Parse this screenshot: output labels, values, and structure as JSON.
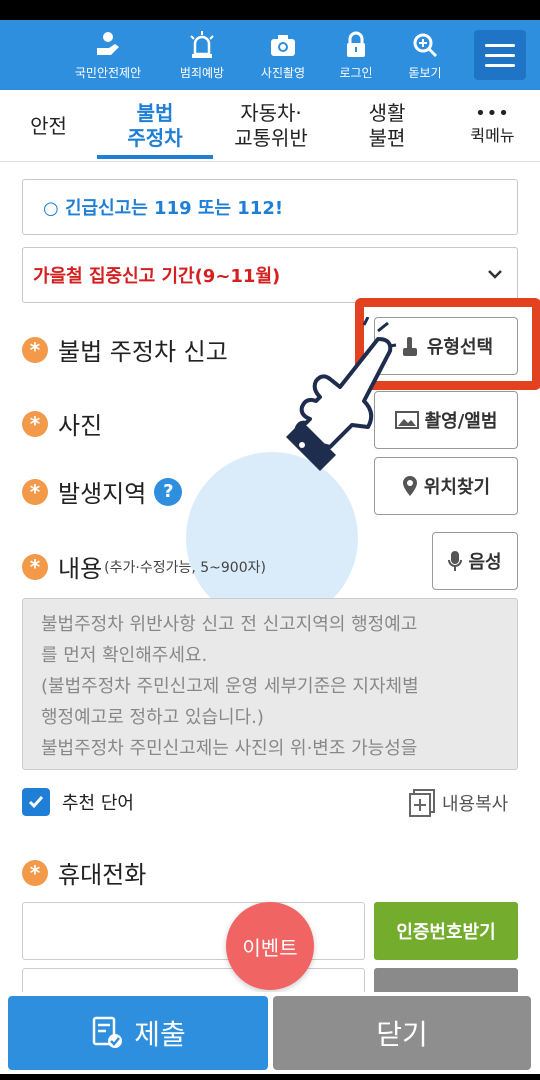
{
  "top_nav": {
    "items": [
      {
        "label": "국민안전제안",
        "icon": "hand-heart-icon"
      },
      {
        "label": "범죄예방",
        "icon": "siren-icon"
      },
      {
        "label": "사진촬영",
        "icon": "camera-icon"
      },
      {
        "label": "로그인",
        "icon": "lock-icon"
      },
      {
        "label": "돋보기",
        "icon": "magnifier-plus-icon"
      }
    ],
    "menu_icon": "hamburger-icon"
  },
  "tabs": {
    "items": [
      {
        "line1": "안전",
        "line2": ""
      },
      {
        "line1": "불법",
        "line2": "주정차"
      },
      {
        "line1": "자동차·",
        "line2": "교통위반"
      },
      {
        "line1": "생활",
        "line2": "불편"
      },
      {
        "line1": "•••",
        "line2": "퀵메뉴"
      }
    ],
    "active_index": 1
  },
  "form": {
    "emergency_text": "○ 긴급신고는 119 또는 112!",
    "period_text": "가을철 집중신고 기간(9~11월)",
    "report_type_label": "불법 주정차 신고",
    "type_select_button": "유형선택",
    "photo_label": "사진",
    "photo_button": "촬영/앨범",
    "location_label": "발생지역",
    "location_button": "위치찾기",
    "content_label": "내용",
    "content_sub": "(추가·수정가능, 5~900자)",
    "voice_button": "음성",
    "content_placeholder_lines": [
      "불법주정차 위반사항 신고 전 신고지역의 행정예고",
      "를 먼저 확인해주세요.",
      "(불법주정차 주민신고제 운영 세부기준은 지자체별",
      "행정예고로 정하고 있습니다.)",
      "불법주정차 주민신고제는 사진의 위·변조 가능성을"
    ],
    "recommend_word": "추천 단어",
    "copy_content": "내용복사",
    "phone_label": "휴대전화",
    "cert_button": "인증번호받기",
    "event_button": "이벤트"
  },
  "bottom": {
    "submit": "제출",
    "close": "닫기"
  },
  "colors": {
    "primary": "#2f8fdf",
    "accent_red": "#d42020",
    "highlight": "#e2421f",
    "green": "#74ad2d",
    "star": "#f29a4a"
  }
}
